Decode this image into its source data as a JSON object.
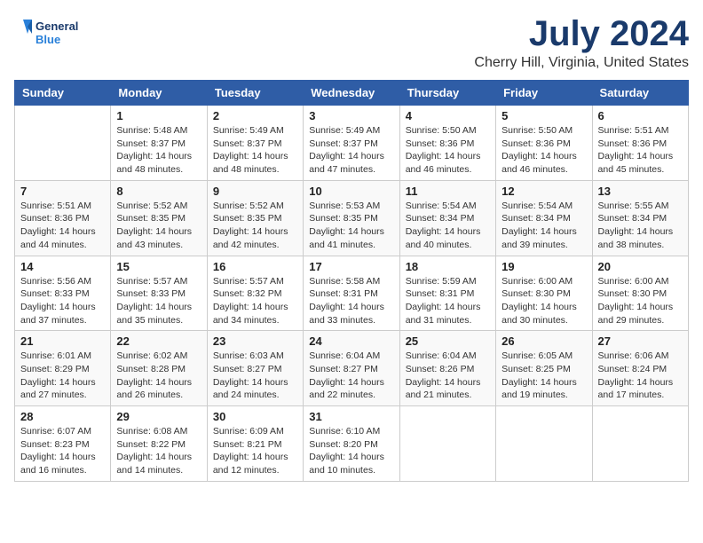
{
  "logo": {
    "line1": "General",
    "line2": "Blue"
  },
  "title": "July 2024",
  "location": "Cherry Hill, Virginia, United States",
  "days": [
    "Sunday",
    "Monday",
    "Tuesday",
    "Wednesday",
    "Thursday",
    "Friday",
    "Saturday"
  ],
  "weeks": [
    [
      {
        "date": "",
        "info": ""
      },
      {
        "date": "1",
        "info": "Sunrise: 5:48 AM\nSunset: 8:37 PM\nDaylight: 14 hours\nand 48 minutes."
      },
      {
        "date": "2",
        "info": "Sunrise: 5:49 AM\nSunset: 8:37 PM\nDaylight: 14 hours\nand 48 minutes."
      },
      {
        "date": "3",
        "info": "Sunrise: 5:49 AM\nSunset: 8:37 PM\nDaylight: 14 hours\nand 47 minutes."
      },
      {
        "date": "4",
        "info": "Sunrise: 5:50 AM\nSunset: 8:36 PM\nDaylight: 14 hours\nand 46 minutes."
      },
      {
        "date": "5",
        "info": "Sunrise: 5:50 AM\nSunset: 8:36 PM\nDaylight: 14 hours\nand 46 minutes."
      },
      {
        "date": "6",
        "info": "Sunrise: 5:51 AM\nSunset: 8:36 PM\nDaylight: 14 hours\nand 45 minutes."
      }
    ],
    [
      {
        "date": "7",
        "info": "Sunrise: 5:51 AM\nSunset: 8:36 PM\nDaylight: 14 hours\nand 44 minutes."
      },
      {
        "date": "8",
        "info": "Sunrise: 5:52 AM\nSunset: 8:35 PM\nDaylight: 14 hours\nand 43 minutes."
      },
      {
        "date": "9",
        "info": "Sunrise: 5:52 AM\nSunset: 8:35 PM\nDaylight: 14 hours\nand 42 minutes."
      },
      {
        "date": "10",
        "info": "Sunrise: 5:53 AM\nSunset: 8:35 PM\nDaylight: 14 hours\nand 41 minutes."
      },
      {
        "date": "11",
        "info": "Sunrise: 5:54 AM\nSunset: 8:34 PM\nDaylight: 14 hours\nand 40 minutes."
      },
      {
        "date": "12",
        "info": "Sunrise: 5:54 AM\nSunset: 8:34 PM\nDaylight: 14 hours\nand 39 minutes."
      },
      {
        "date": "13",
        "info": "Sunrise: 5:55 AM\nSunset: 8:34 PM\nDaylight: 14 hours\nand 38 minutes."
      }
    ],
    [
      {
        "date": "14",
        "info": "Sunrise: 5:56 AM\nSunset: 8:33 PM\nDaylight: 14 hours\nand 37 minutes."
      },
      {
        "date": "15",
        "info": "Sunrise: 5:57 AM\nSunset: 8:33 PM\nDaylight: 14 hours\nand 35 minutes."
      },
      {
        "date": "16",
        "info": "Sunrise: 5:57 AM\nSunset: 8:32 PM\nDaylight: 14 hours\nand 34 minutes."
      },
      {
        "date": "17",
        "info": "Sunrise: 5:58 AM\nSunset: 8:31 PM\nDaylight: 14 hours\nand 33 minutes."
      },
      {
        "date": "18",
        "info": "Sunrise: 5:59 AM\nSunset: 8:31 PM\nDaylight: 14 hours\nand 31 minutes."
      },
      {
        "date": "19",
        "info": "Sunrise: 6:00 AM\nSunset: 8:30 PM\nDaylight: 14 hours\nand 30 minutes."
      },
      {
        "date": "20",
        "info": "Sunrise: 6:00 AM\nSunset: 8:30 PM\nDaylight: 14 hours\nand 29 minutes."
      }
    ],
    [
      {
        "date": "21",
        "info": "Sunrise: 6:01 AM\nSunset: 8:29 PM\nDaylight: 14 hours\nand 27 minutes."
      },
      {
        "date": "22",
        "info": "Sunrise: 6:02 AM\nSunset: 8:28 PM\nDaylight: 14 hours\nand 26 minutes."
      },
      {
        "date": "23",
        "info": "Sunrise: 6:03 AM\nSunset: 8:27 PM\nDaylight: 14 hours\nand 24 minutes."
      },
      {
        "date": "24",
        "info": "Sunrise: 6:04 AM\nSunset: 8:27 PM\nDaylight: 14 hours\nand 22 minutes."
      },
      {
        "date": "25",
        "info": "Sunrise: 6:04 AM\nSunset: 8:26 PM\nDaylight: 14 hours\nand 21 minutes."
      },
      {
        "date": "26",
        "info": "Sunrise: 6:05 AM\nSunset: 8:25 PM\nDaylight: 14 hours\nand 19 minutes."
      },
      {
        "date": "27",
        "info": "Sunrise: 6:06 AM\nSunset: 8:24 PM\nDaylight: 14 hours\nand 17 minutes."
      }
    ],
    [
      {
        "date": "28",
        "info": "Sunrise: 6:07 AM\nSunset: 8:23 PM\nDaylight: 14 hours\nand 16 minutes."
      },
      {
        "date": "29",
        "info": "Sunrise: 6:08 AM\nSunset: 8:22 PM\nDaylight: 14 hours\nand 14 minutes."
      },
      {
        "date": "30",
        "info": "Sunrise: 6:09 AM\nSunset: 8:21 PM\nDaylight: 14 hours\nand 12 minutes."
      },
      {
        "date": "31",
        "info": "Sunrise: 6:10 AM\nSunset: 8:20 PM\nDaylight: 14 hours\nand 10 minutes."
      },
      {
        "date": "",
        "info": ""
      },
      {
        "date": "",
        "info": ""
      },
      {
        "date": "",
        "info": ""
      }
    ]
  ]
}
